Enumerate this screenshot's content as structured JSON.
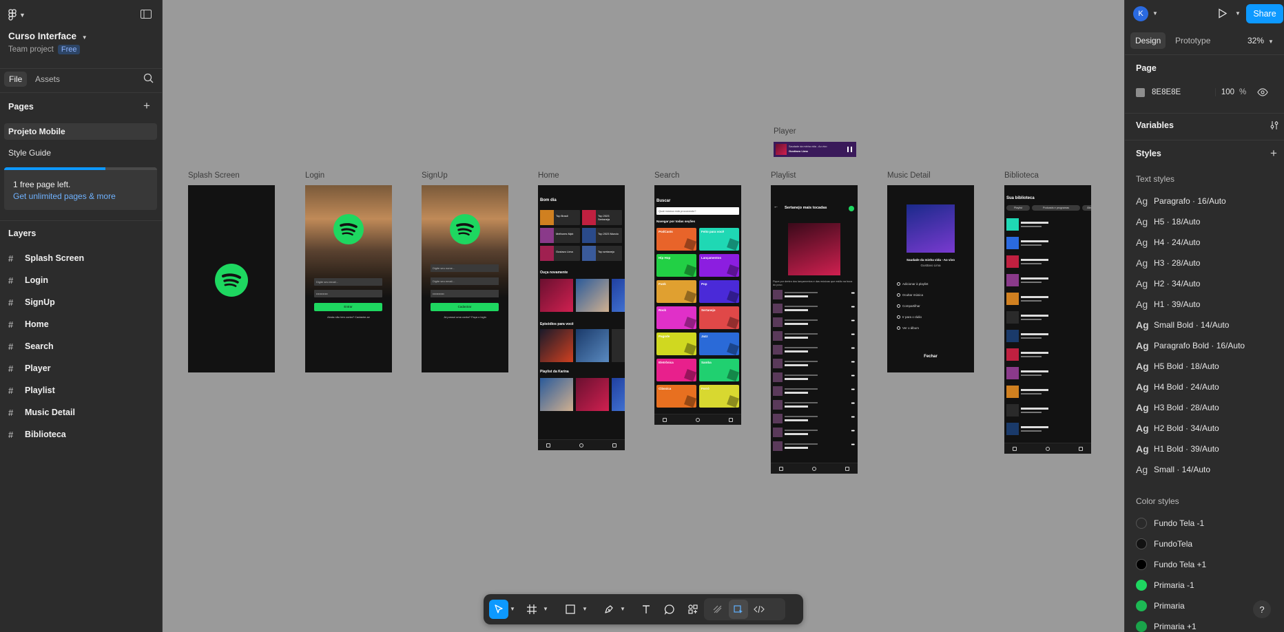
{
  "project": {
    "name": "Curso Interface",
    "team": "Team project",
    "plan_badge": "Free"
  },
  "left_tabs": {
    "file": "File",
    "assets": "Assets"
  },
  "pages": {
    "title": "Pages",
    "items": [
      "Projeto Mobile",
      "Style Guide"
    ],
    "selected": "Projeto Mobile"
  },
  "upsell": {
    "text": "1 free page left.",
    "link": "Get unlimited pages & more",
    "progress": 0.66
  },
  "layers": {
    "title": "Layers",
    "items": [
      "Splash Screen",
      "Login",
      "SignUp",
      "Home",
      "Search",
      "Player",
      "Playlist",
      "Music Detail",
      "Biblioteca"
    ]
  },
  "frames": {
    "splash": "Splash Screen",
    "login": "Login",
    "signup": "SignUp",
    "home": "Home",
    "search": "Search",
    "player": "Player",
    "playlist": "Playlist",
    "music": "Music Detail",
    "biblioteca": "Biblioteca"
  },
  "mock": {
    "login_email": "Digite seu email...",
    "login_pass": "••••••••••••",
    "login_btn": "Entrar",
    "login_foot": "Ainda não tem conta? Cadastre-se",
    "signup_name": "Digite seu nome...",
    "signup_email": "Digite seu email...",
    "signup_pass": "••••••••••••",
    "signup_btn": "Cadastrar",
    "signup_foot": "Já possui uma conta? Faça o login",
    "home_greet": "Bom dia",
    "home_sec1": "Ouça novamente",
    "home_sec2": "Episódios para você",
    "home_sec3": "Playlist da Karina",
    "home_tiles": [
      "Top Brasil",
      "Top 2023 Sertaneja",
      "Melhores Mpb",
      "Top 2023 Mundo",
      "Gustavo Lima",
      "Top sertanejo"
    ],
    "search_title": "Buscar",
    "search_placeholder": "Qual música está procurando?",
    "search_section": "Navegar por todas seções",
    "genres": [
      "PodCasts",
      "Feito para você",
      "Hip Hop",
      "Lançamentos",
      "Funk",
      "Pop",
      "Rock",
      "Sertanejo",
      "Pagode",
      "Jazz",
      "Eletrônica",
      "Samba",
      "Clássica",
      "Forró"
    ],
    "genre_colors": [
      "#e8642a",
      "#1fd8b4",
      "#22d045",
      "#8c1ee0",
      "#e0a030",
      "#4a2ad8",
      "#e030c8",
      "#e04848",
      "#d0d820",
      "#2a6ad8",
      "#e8208c",
      "#20d070",
      "#e87020",
      "#d8d830"
    ],
    "player_song": "Saudade da minha vida - Ao vivo",
    "player_artist": "Gusttavo Lima",
    "playlist_title": "Sertanejo mais tocadas",
    "playlist_desc": "Fique por dentro dos lançamentos e das músicas que estão na boca do povo",
    "music_song": "Saudade da minha vida - Ao vivo",
    "music_artist": "Gusttavo Lima",
    "music_opts": [
      "Adicionar à playlist",
      "Ocultar música",
      "Compartilhar",
      "Ir para o rádio",
      "Ver o álbum"
    ],
    "music_close": "Fechar",
    "lib_title": "Sua biblioteca",
    "lib_chips": [
      "Playlist",
      "Podcasts e programas",
      "Álbum"
    ]
  },
  "right": {
    "avatar": "K",
    "share": "Share",
    "tabs": {
      "design": "Design",
      "prototype": "Prototype"
    },
    "zoom": "32%",
    "page_title": "Page",
    "page_color": "8E8E8E",
    "page_opacity": "100",
    "percent": "%",
    "variables": "Variables",
    "styles": "Styles",
    "text_styles_title": "Text styles",
    "ag": "Ag",
    "text_styles": [
      "Paragrafo · 16/Auto",
      "H5 · 18/Auto",
      "H4 · 24/Auto",
      "H3 · 28/Auto",
      "H2 · 34/Auto",
      "H1 · 39/Auto",
      "Small Bold · 14/Auto",
      "Paragrafo Bold · 16/Auto",
      "H5 Bold · 18/Auto",
      "H4 Bold · 24/Auto",
      "H3 Bold · 28/Auto",
      "H2 Bold · 34/Auto",
      "H1 Bold · 39/Auto",
      "Small · 14/Auto"
    ],
    "color_styles_title": "Color styles",
    "color_styles": [
      {
        "name": "Fundo Tela -1",
        "color": "#2a2a2a"
      },
      {
        "name": "FundoTela",
        "color": "#121212"
      },
      {
        "name": "Fundo Tela +1",
        "color": "#000000"
      },
      {
        "name": "Primaria -1",
        "color": "#1ed760"
      },
      {
        "name": "Primaria",
        "color": "#1db954"
      },
      {
        "name": "Primaria +1",
        "color": "#1aa34a"
      }
    ],
    "help": "?"
  }
}
